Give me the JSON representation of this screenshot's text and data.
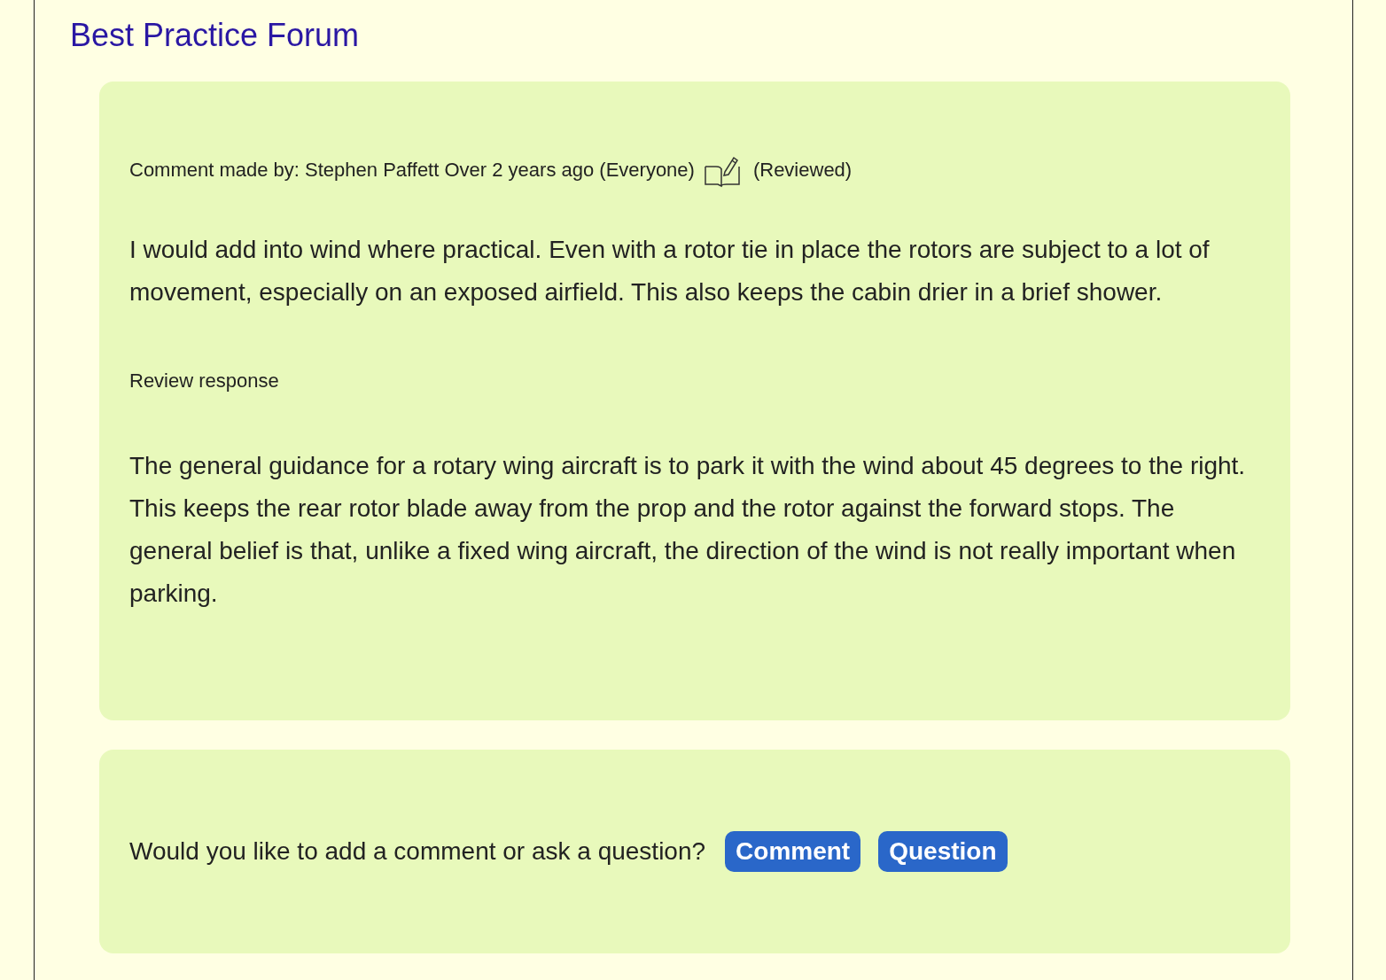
{
  "forum_title": "Best Practice Forum",
  "post": {
    "meta": "Comment made by: Stephen Paffett Over 2 years ago (Everyone)",
    "status": "(Reviewed)",
    "body": "I would add into wind where practical. Even with a rotor tie in place the rotors are subject to a lot of movement, especially on an exposed airfield. This also keeps the cabin drier in a brief shower.",
    "review_label": "Review response",
    "review_body": "The general guidance for a rotary wing aircraft is to park it with the wind about 45 degrees to the right. This keeps the rear rotor blade away from the prop and the rotor against the forward stops. The general belief is that, unlike a fixed wing aircraft, the direction of the wind is not really important when parking."
  },
  "prompt": {
    "text": "Would you like to add a comment or ask a question?",
    "buttons": [
      "Comment",
      "Question"
    ]
  }
}
